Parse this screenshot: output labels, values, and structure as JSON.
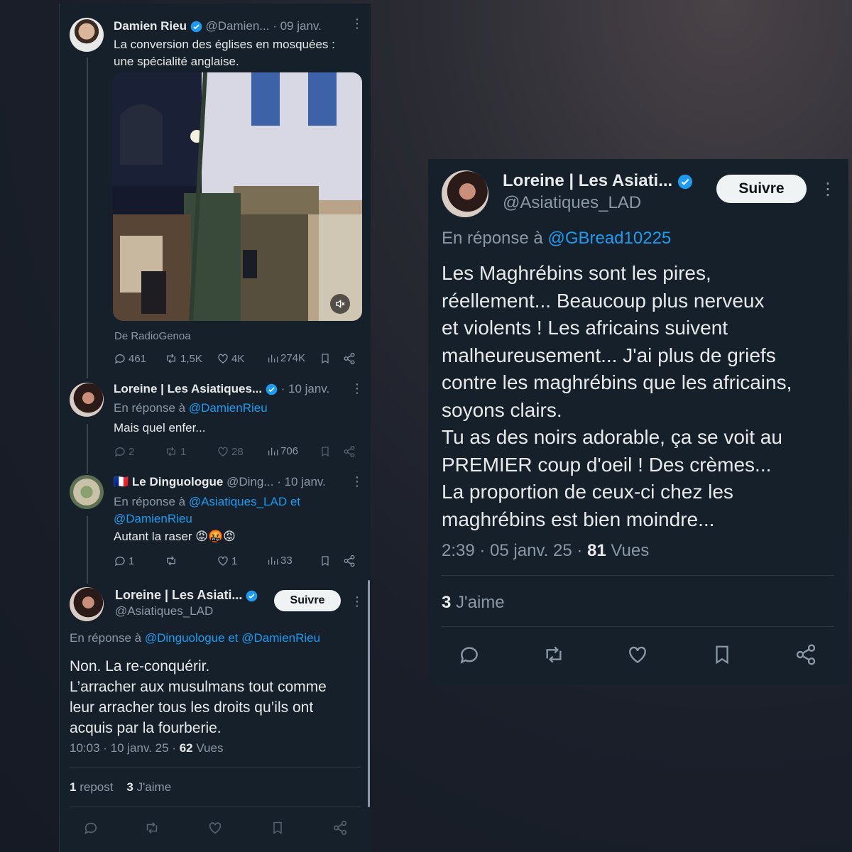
{
  "left_thread": {
    "tweet1": {
      "author_name": "Damien Rieu",
      "handle": "@Damien...",
      "date": "· 09 janv.",
      "text_line1": "La conversion des églises en mosquées :",
      "text_line2": "une spécialité anglaise.",
      "source": "De RadioGenoa",
      "stats": {
        "replies": "461",
        "reposts": "1,5K",
        "likes": "4K",
        "views": "274K"
      }
    },
    "tweet2": {
      "author_name": "Loreine | Les Asiatiques...",
      "date": "· 10 janv.",
      "reply_prefix": "En réponse à",
      "reply_to": "@DamienRieu",
      "text": "Mais quel enfer...",
      "stats": {
        "replies": "2",
        "reposts": "1",
        "likes": "28",
        "views": "706"
      }
    },
    "tweet3": {
      "flag": "🇫🇷",
      "author_name": "Le Dinguologue",
      "handle": "@Ding...",
      "date": "· 10 janv.",
      "reply_prefix": "En réponse à",
      "reply_to_1": "@Asiatiques_LAD",
      "reply_and": "et",
      "reply_to_2": "@DamienRieu",
      "text": "Autant la raser 😡🤬😡",
      "stats": {
        "replies": "1",
        "likes": "1",
        "views": "33"
      }
    },
    "tweet4": {
      "author_name": "Loreine | Les Asiati...",
      "handle": "@Asiatiques_LAD",
      "follow_label": "Suivre",
      "reply_prefix": "En réponse à",
      "reply_to_1": "@Dinguologue",
      "reply_and": "et",
      "reply_to_2": "@DamienRieu",
      "text_lines": [
        "Non. La re-conquérir.",
        "L’arracher aux musulmans tout comme",
        "leur arracher tous les droits qu’ils ont",
        "acquis par la fourberie."
      ],
      "timestamp": "10:03 · 10 janv. 25 ·",
      "views_count": "62",
      "views_label": "Vues",
      "reposts_count": "1",
      "reposts_label": "repost",
      "likes_count": "3",
      "likes_label": "J'aime"
    }
  },
  "right_tweet": {
    "author_name": "Loreine | Les Asiati...",
    "handle": "@Asiatiques_LAD",
    "follow_label": "Suivre",
    "reply_prefix": "En réponse à",
    "reply_to": "@GBread10225",
    "text_lines": [
      "Les Maghrébins sont les pires,",
      "réellement... Beaucoup plus nerveux",
      "et violents ! Les africains suivent",
      "malheureusement... J'ai plus de griefs",
      "contre les maghrébins que les africains,",
      "soyons clairs.",
      "Tu as des noirs adorable, ça se voit au",
      "PREMIER coup d'oeil ! Des crèmes...",
      "La proportion de ceux-ci chez les",
      "maghrébins est bien moindre..."
    ],
    "timestamp": "2:39 · 05 janv. 25 ·",
    "views_count": "81",
    "views_label": "Vues",
    "likes_count": "3",
    "likes_label": "J'aime"
  },
  "colors": {
    "background": "#15202b",
    "accent": "#1d9bf0",
    "text": "#e7e9ea",
    "muted": "#8b98a5"
  }
}
